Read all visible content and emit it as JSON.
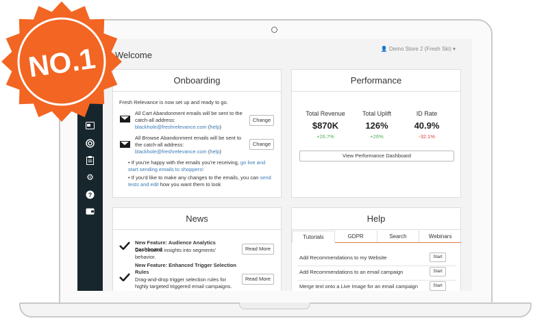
{
  "header": {
    "welcome": "Welcome",
    "store": "Demo Store 2 (Fresh Ski)"
  },
  "onboarding": {
    "title": "Onboarding",
    "intro": "Fresh Relevance is now set up and ready to go.",
    "cart_text": "All Cart Abandonment emails will be sent to the catch-all address:",
    "cart_email": "blackhole@freshrelevance.com",
    "help_link": "help",
    "browse_text": "All Browse Abandonment emails will be sent to the catch-all address:",
    "browse_email": "blackhole@freshrelevance.com",
    "change_label": "Change",
    "bullet1_text": "If you're happy with the emails you're receiving,",
    "bullet1_link": "go live and start sending emails to shoppers!",
    "bullet2_text": "If you'd like to make any changes to the emails, you can",
    "bullet2_link": "send tests and edit",
    "bullet2_tail": "how you want them to look"
  },
  "performance": {
    "title": "Performance",
    "metrics": [
      {
        "label": "Total Revenue",
        "value": "$870K",
        "change": "+26.7%",
        "color": "#4caf50"
      },
      {
        "label": "Total Uplift",
        "value": "126%",
        "change": "+26%",
        "color": "#4caf50"
      },
      {
        "label": "ID Rate",
        "value": "40.9%",
        "change": "-32.1%",
        "color": "#e53935"
      }
    ],
    "dashboard_button": "View Performance Dashboard"
  },
  "news": {
    "title": "News",
    "items": [
      {
        "title": "New Feature: Audience Analytics Dashboard",
        "desc": "Get detailed insights into segments' behavior.",
        "button": "Read More"
      },
      {
        "title": "New Feature: Enhanced Trigger Selection Rules",
        "desc": "Drag-and-drop trigger selection rules for highly targeted triggered email campaigns.",
        "button": "Read More"
      }
    ]
  },
  "help": {
    "title": "Help",
    "tabs": [
      "Tutorials",
      "GDPR",
      "Search",
      "Webinars"
    ],
    "rows": [
      {
        "text": "Add Recommendations to my Website",
        "button": "Start"
      },
      {
        "text": "Add Recommendations to an email campaign",
        "button": "Start"
      },
      {
        "text": "Merge text onto a Live Image for an email campaign",
        "button": "Start"
      }
    ]
  },
  "badge": {
    "text": "NO.1",
    "color": "#f26522"
  },
  "icons": [
    "card-icon",
    "target-icon",
    "clipboard-icon",
    "gear-icon",
    "question-icon",
    "wallet-icon",
    "envelope-icon",
    "checkmark-icon",
    "user-icon"
  ]
}
